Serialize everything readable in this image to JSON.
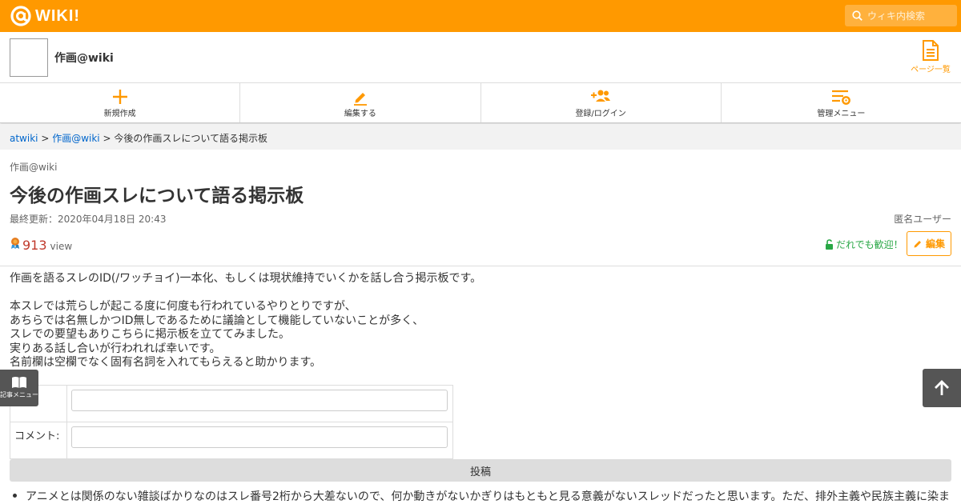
{
  "brand": {
    "logo_text": "WIKI!",
    "accent": "#ff9900"
  },
  "search": {
    "placeholder": "ウィキ内検索"
  },
  "site": {
    "title": "作画@wiki",
    "page_list_label": "ページ一覧"
  },
  "actions": [
    {
      "label": "新規作成",
      "icon": "plus-icon"
    },
    {
      "label": "編集する",
      "icon": "pencil-icon"
    },
    {
      "label": "登録/ログイン",
      "icon": "user-plus-icon"
    },
    {
      "label": "管理メニュー",
      "icon": "settings-menu-icon"
    }
  ],
  "breadcrumb": {
    "root": "atwiki",
    "sep": " > ",
    "wiki": "作画@wiki",
    "current": "今後の作画スレについて語る掲示板"
  },
  "page": {
    "wiki_name": "作画@wiki",
    "title": "今後の作画スレについて語る掲示板",
    "last_updated": "最終更新：2020年04月18日 20:43",
    "author": "匿名ユーザー",
    "views": "913",
    "views_unit": "view",
    "welcome": "だれでも歓迎！",
    "edit_label": "編集"
  },
  "body": {
    "intro": "作画を語るスレのID(/ワッチョイ)一本化、もしくは現状維持でいくかを話し合う掲示板です。",
    "lines": [
      "本スレでは荒らしが起こる度に何度も行われているやりとりですが、",
      "あちらでは名無しかつID無しであるために議論として機能していないことが多く、",
      "スレでの要望もありこちらに掲示板を立ててみました。",
      "実りある話し合いが行われれば幸いです。",
      "名前欄は空欄でなく固有名詞を入れてもらえると助かります。"
    ]
  },
  "form": {
    "name_label": "",
    "comment_label": "コメント:",
    "submit_label": "投稿"
  },
  "posts": [
    "アニメとは関係のない雑談ばかりなのはスレ番号2桁から大差ないので、何か動きがないかぎりはもともと見る意義がないスレッドだったと思います。ただ、排外主義や民族主義に染ま"
  ],
  "floating": {
    "article_menu_label": "記事メニュー"
  }
}
